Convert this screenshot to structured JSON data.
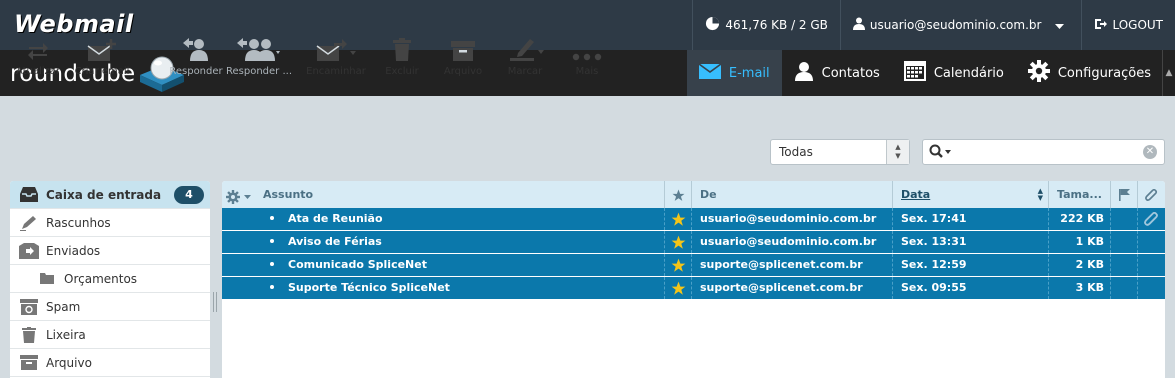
{
  "header": {
    "brand": "Webmail",
    "quota": "461,76 KB / 2 GB",
    "user": "usuario@seudominio.com.br",
    "logout": "LOGOUT"
  },
  "logo": {
    "text": "roundcube"
  },
  "nav": {
    "items": [
      {
        "label": "E-mail",
        "icon": "envelope-icon",
        "active": true
      },
      {
        "label": "Contatos",
        "icon": "person-icon"
      },
      {
        "label": "Calendário",
        "icon": "calendar-icon"
      },
      {
        "label": "Configurações",
        "icon": "gear-icon"
      }
    ]
  },
  "toolbar": {
    "refresh": "Atualizar",
    "compose": "Criar email",
    "reply": "Responder",
    "reply_all": "Responder ...",
    "forward": "Encaminhar",
    "delete": "Excluir",
    "archive": "Arquivo",
    "mark": "Marcar",
    "more": "Mais"
  },
  "filter": {
    "selected": "Todas"
  },
  "search": {
    "placeholder": ""
  },
  "folders": {
    "inbox": {
      "label": "Caixa de entrada",
      "count": "4"
    },
    "drafts": "Rascunhos",
    "sent": "Enviados",
    "budgets": "Orçamentos",
    "spam": "Spam",
    "trash": "Lixeira",
    "archive": "Arquivo"
  },
  "columns": {
    "subject": "Assunto",
    "from": "De",
    "date": "Data",
    "size": "Tama..."
  },
  "messages": [
    {
      "subject": "Ata de Reunião",
      "from": "usuario@seudominio.com.br",
      "date": "Sex. 17:41",
      "size": "222 KB",
      "attachment": true
    },
    {
      "subject": "Aviso de Férias",
      "from": "usuario@seudominio.com.br",
      "date": "Sex. 13:31",
      "size": "1 KB",
      "attachment": false
    },
    {
      "subject": "Comunicado SpliceNet",
      "from": "suporte@splicenet.com.br",
      "date": "Sex. 12:59",
      "size": "2 KB",
      "attachment": false
    },
    {
      "subject": "Suporte Técnico SpliceNet",
      "from": "suporte@splicenet.com.br",
      "date": "Sex. 09:55",
      "size": "3 KB",
      "attachment": false
    }
  ],
  "colors": {
    "topbar": "#2e3a46",
    "navbar": "#222222",
    "accent": "#37beff",
    "selected_row": "#0b78ab",
    "star": "#f5c518"
  }
}
